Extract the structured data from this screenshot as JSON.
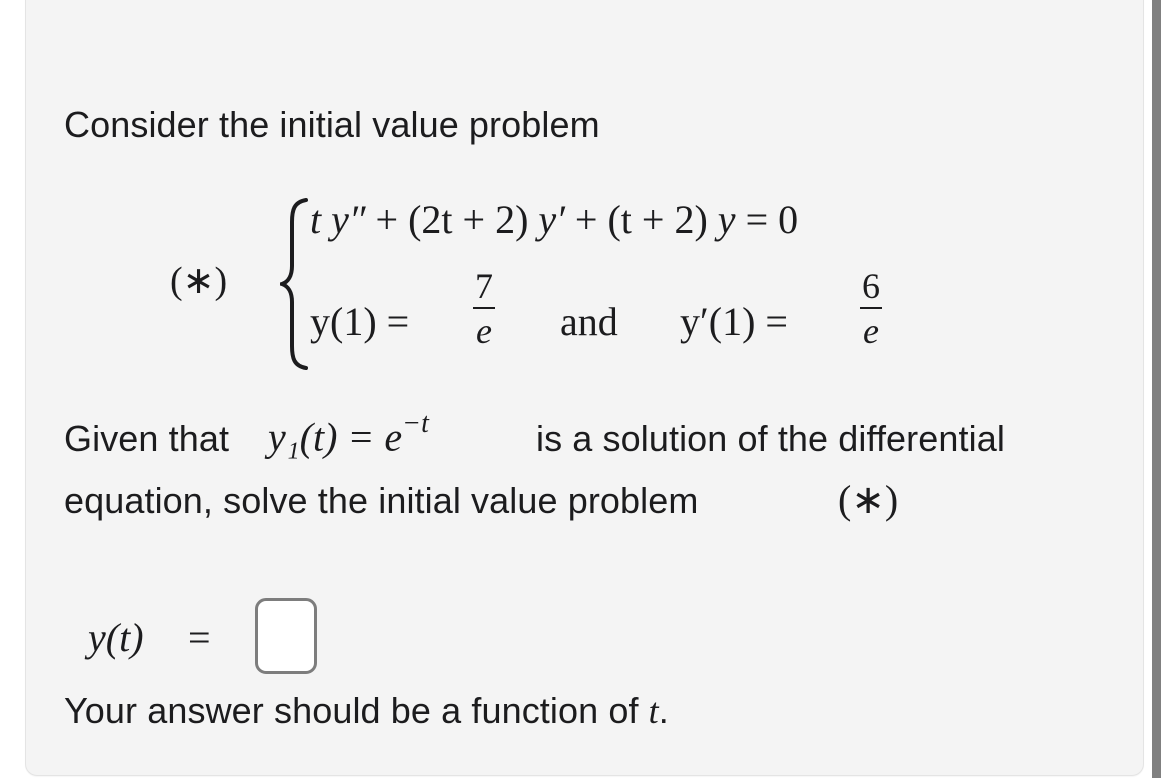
{
  "problem": {
    "intro": "Consider the initial value problem",
    "label": "(∗)",
    "ode": {
      "t_term": "t y″",
      "plus1": " + ",
      "coef1": "(2t + 2)",
      "y_prime": " y′",
      "plus2": " + ",
      "coef2": "(t + 2)",
      "y": " y",
      "equals_zero": " = 0"
    },
    "initial_conditions": {
      "y1_lhs": "y(1) =",
      "y1_num": "7",
      "y1_den": "e",
      "connector": "and",
      "yp1_lhs": "y′(1) =",
      "yp1_num": "6",
      "yp1_den": "e"
    },
    "given": {
      "prefix": "Given that",
      "solution": "y₁(t) = e",
      "exponent": "−t",
      "suffix": "is a solution of the differential",
      "line2": "equation, solve the initial value problem",
      "line2_ref": "(∗)"
    }
  },
  "answer": {
    "label": "y(t)",
    "equals": "=",
    "value": "",
    "hint_prefix": "Your answer should be a function of ",
    "hint_var": "t",
    "hint_suffix": "."
  },
  "colors": {
    "card_background": "#f4f4f4",
    "text": "#1c1c1e",
    "input_border": "#7d7d7d",
    "scrollbar": "#808080"
  }
}
